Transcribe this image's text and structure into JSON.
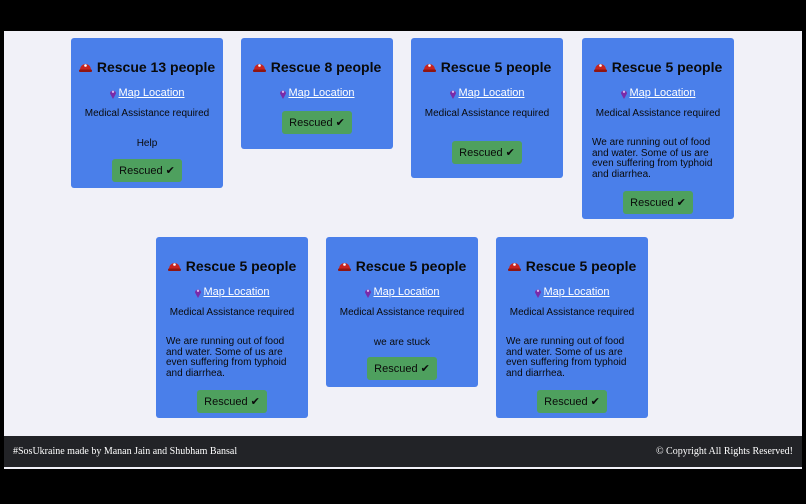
{
  "cards": [
    {
      "title": "Rescue 13 people",
      "map_label": "Map Location",
      "medical": "Medical Assistance required",
      "message": "Help",
      "button": "Rescued ✔"
    },
    {
      "title": "Rescue 8 people",
      "map_label": "Map Location",
      "medical": "",
      "message": "",
      "button": "Rescued ✔"
    },
    {
      "title": "Rescue 5 people",
      "map_label": "Map Location",
      "medical": "Medical Assistance required",
      "message": "",
      "button": "Rescued ✔"
    },
    {
      "title": "Rescue 5 people",
      "map_label": "Map Location",
      "medical": "Medical Assistance required",
      "message": "We are running out of food and water. Some of us are even suffering from typhoid and diarrhea.",
      "button": "Rescued ✔"
    },
    {
      "title": "Rescue 5 people",
      "map_label": "Map Location",
      "medical": "Medical Assistance required",
      "message": "We are running out of food and water. Some of us are even suffering from typhoid and diarrhea.",
      "button": "Rescued ✔"
    },
    {
      "title": "Rescue 5 people",
      "map_label": "Map Location",
      "medical": "Medical Assistance required",
      "message": "we are stuck",
      "button": "Rescued ✔"
    },
    {
      "title": "Rescue 5 people",
      "map_label": "Map Location",
      "medical": "Medical Assistance required",
      "message": "We are running out of food and water. Some of us are even suffering from typhoid and diarrhea.",
      "button": "Rescued ✔"
    }
  ],
  "footer": {
    "credit": "#SosUkraine made by Manan Jain and Shubham Bansal",
    "copyright": "© Copyright All Rights Reserved!"
  },
  "icons": {
    "title_icon": "helmet-icon",
    "map_icon": "map-pin-icon"
  },
  "colors": {
    "card": "#4a7fea",
    "button": "#4ea05e",
    "footer": "#222327",
    "background": "#f1f1f8"
  }
}
